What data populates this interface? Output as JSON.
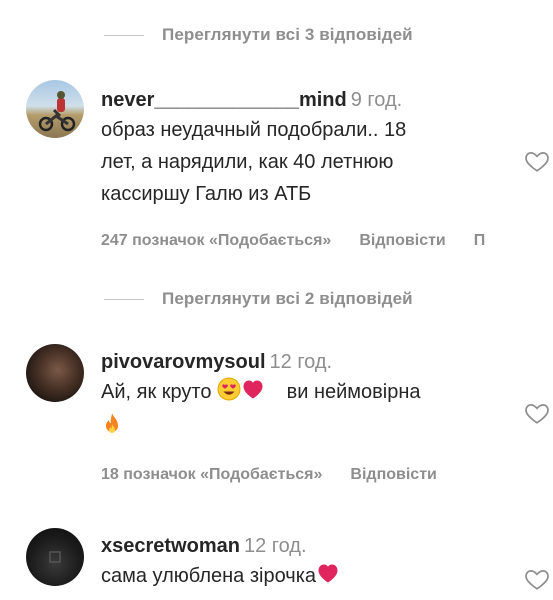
{
  "threads": [
    {
      "view_replies": "Переглянути всі 3 відповідей",
      "comment": {
        "username": "never_____________mind",
        "time": "9 год.",
        "text_lines": [
          "образ неудачный подобрали.. 18",
          "лет, а нарядили, как 40 летнюю",
          "кассиршу Галю из АТБ"
        ],
        "likes": "247 позначок «Подобається»",
        "reply": "Відповісти",
        "more": "П"
      }
    },
    {
      "view_replies": "Переглянути всі 2 відповідей",
      "comment": {
        "username": "pivovarovmysoul",
        "time": "12 год.",
        "text_before": "Ай, як круто",
        "text_after": "ви неймовірна",
        "likes": "18 позначок «Подобається»",
        "reply": "Відповісти"
      }
    },
    {
      "comment": {
        "username": "xsecretwoman",
        "time": "12 год.",
        "text": "сама улюблена зірочка"
      }
    }
  ],
  "icons": {
    "like": "heart-outline-icon",
    "emoji_1": "heart-eyes-emoji",
    "emoji_2": "red-heart-emoji",
    "emoji_3": "fire-emoji"
  },
  "colors": {
    "primary_text": "#262626",
    "secondary_text": "#8e8e8e",
    "heart": "#e0245e"
  }
}
